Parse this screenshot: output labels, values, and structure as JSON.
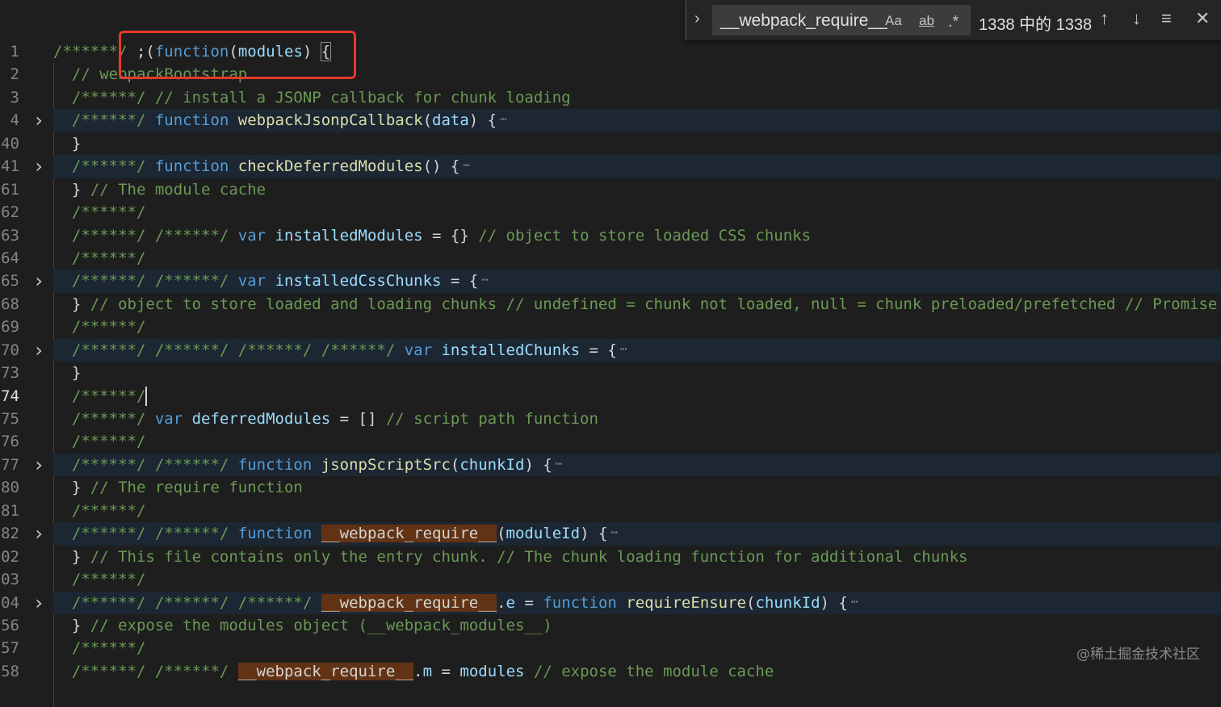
{
  "find_widget": {
    "query": "__webpack_require__",
    "match_case_label": "Aa",
    "whole_word_label": "ab",
    "regex_label": ".*",
    "result_count": "1338 中的 1338",
    "toggle_icon": "chevron-right",
    "prev_icon": "arrow-up",
    "next_icon": "arrow-down",
    "selection_icon": "find-in-selection",
    "close_icon": "close"
  },
  "colors": {
    "comment": "#6a9955",
    "keyword": "#569cd6",
    "function": "#dcdcaa",
    "variable": "#9cdcfe",
    "match": "#613214",
    "annotation": "#e5392a"
  },
  "watermark": "@稀土掘金技术社区",
  "lines": [
    {
      "num": "1",
      "tokens": [
        {
          "c": "c",
          "t": "/******/ "
        },
        {
          "c": "p",
          "t": ";("
        },
        {
          "c": "k",
          "t": "function"
        },
        {
          "c": "p",
          "t": "("
        },
        {
          "c": "v",
          "t": "modules"
        },
        {
          "c": "p",
          "t": ") "
        },
        {
          "c": "b",
          "t": "{"
        }
      ]
    },
    {
      "num": "2",
      "tokens": [
        {
          "c": "p",
          "t": "  "
        },
        {
          "c": "c",
          "t": "// webpackBootstrap"
        }
      ]
    },
    {
      "num": "3",
      "tokens": [
        {
          "c": "p",
          "t": "  "
        },
        {
          "c": "c",
          "t": "/******/ // install a JSONP callback for chunk loading"
        }
      ]
    },
    {
      "num": "4",
      "folded": true,
      "tokens": [
        {
          "c": "p",
          "t": "  "
        },
        {
          "c": "c",
          "t": "/******/ "
        },
        {
          "c": "k",
          "t": "function "
        },
        {
          "c": "f",
          "t": "webpackJsonpCallback"
        },
        {
          "c": "p",
          "t": "("
        },
        {
          "c": "v",
          "t": "data"
        },
        {
          "c": "p",
          "t": ") {"
        }
      ]
    },
    {
      "num": "40",
      "tokens": [
        {
          "c": "p",
          "t": "  }"
        }
      ]
    },
    {
      "num": "41",
      "folded": true,
      "tokens": [
        {
          "c": "p",
          "t": "  "
        },
        {
          "c": "c",
          "t": "/******/ "
        },
        {
          "c": "k",
          "t": "function "
        },
        {
          "c": "f",
          "t": "checkDeferredModules"
        },
        {
          "c": "p",
          "t": "() {"
        }
      ]
    },
    {
      "num": "61",
      "tokens": [
        {
          "c": "p",
          "t": "  } "
        },
        {
          "c": "c",
          "t": "// The module cache"
        }
      ]
    },
    {
      "num": "62",
      "tokens": [
        {
          "c": "p",
          "t": "  "
        },
        {
          "c": "c",
          "t": "/******/"
        }
      ]
    },
    {
      "num": "63",
      "tokens": [
        {
          "c": "p",
          "t": "  "
        },
        {
          "c": "c",
          "t": "/******/ /******/ "
        },
        {
          "c": "k",
          "t": "var "
        },
        {
          "c": "v",
          "t": "installedModules"
        },
        {
          "c": "p",
          "t": " = {} "
        },
        {
          "c": "c",
          "t": "// object to store loaded CSS chunks"
        }
      ]
    },
    {
      "num": "64",
      "tokens": [
        {
          "c": "p",
          "t": "  "
        },
        {
          "c": "c",
          "t": "/******/"
        }
      ]
    },
    {
      "num": "65",
      "folded": true,
      "tokens": [
        {
          "c": "p",
          "t": "  "
        },
        {
          "c": "c",
          "t": "/******/ /******/ "
        },
        {
          "c": "k",
          "t": "var "
        },
        {
          "c": "v",
          "t": "installedCssChunks"
        },
        {
          "c": "p",
          "t": " = {"
        }
      ]
    },
    {
      "num": "68",
      "tokens": [
        {
          "c": "p",
          "t": "  } "
        },
        {
          "c": "c",
          "t": "// object to store loaded and loading chunks // undefined = chunk not loaded, null = chunk preloaded/prefetched // Promise"
        }
      ]
    },
    {
      "num": "69",
      "tokens": [
        {
          "c": "p",
          "t": "  "
        },
        {
          "c": "c",
          "t": "/******/"
        }
      ]
    },
    {
      "num": "70",
      "folded": true,
      "tokens": [
        {
          "c": "p",
          "t": "  "
        },
        {
          "c": "c",
          "t": "/******/ /******/ /******/ /******/ "
        },
        {
          "c": "k",
          "t": "var "
        },
        {
          "c": "v",
          "t": "installedChunks"
        },
        {
          "c": "p",
          "t": " = {"
        }
      ]
    },
    {
      "num": "73",
      "tokens": [
        {
          "c": "p",
          "t": "  }"
        }
      ]
    },
    {
      "num": "74",
      "current": true,
      "tokens": [
        {
          "c": "p",
          "t": "  "
        },
        {
          "c": "c",
          "t": "/******/"
        }
      ]
    },
    {
      "num": "75",
      "tokens": [
        {
          "c": "p",
          "t": "  "
        },
        {
          "c": "c",
          "t": "/******/ "
        },
        {
          "c": "k",
          "t": "var "
        },
        {
          "c": "v",
          "t": "deferredModules"
        },
        {
          "c": "p",
          "t": " = [] "
        },
        {
          "c": "c",
          "t": "// script path function"
        }
      ]
    },
    {
      "num": "76",
      "tokens": [
        {
          "c": "p",
          "t": "  "
        },
        {
          "c": "c",
          "t": "/******/"
        }
      ]
    },
    {
      "num": "77",
      "folded": true,
      "tokens": [
        {
          "c": "p",
          "t": "  "
        },
        {
          "c": "c",
          "t": "/******/ /******/ "
        },
        {
          "c": "k",
          "t": "function "
        },
        {
          "c": "f",
          "t": "jsonpScriptSrc"
        },
        {
          "c": "p",
          "t": "("
        },
        {
          "c": "v",
          "t": "chunkId"
        },
        {
          "c": "p",
          "t": ") {"
        }
      ]
    },
    {
      "num": "80",
      "tokens": [
        {
          "c": "p",
          "t": "  } "
        },
        {
          "c": "c",
          "t": "// The require function"
        }
      ]
    },
    {
      "num": "81",
      "tokens": [
        {
          "c": "p",
          "t": "  "
        },
        {
          "c": "c",
          "t": "/******/"
        }
      ]
    },
    {
      "num": "82",
      "folded": true,
      "tokens": [
        {
          "c": "p",
          "t": "  "
        },
        {
          "c": "c",
          "t": "/******/ /******/ "
        },
        {
          "c": "k",
          "t": "function "
        },
        {
          "c": "m",
          "t": "__webpack_require__"
        },
        {
          "c": "p",
          "t": "("
        },
        {
          "c": "v",
          "t": "moduleId"
        },
        {
          "c": "p",
          "t": ") {"
        }
      ]
    },
    {
      "num": "02",
      "tokens": [
        {
          "c": "p",
          "t": "  } "
        },
        {
          "c": "c",
          "t": "// This file contains only the entry chunk. // The chunk loading function for additional chunks"
        }
      ]
    },
    {
      "num": "03",
      "tokens": [
        {
          "c": "p",
          "t": "  "
        },
        {
          "c": "c",
          "t": "/******/"
        }
      ]
    },
    {
      "num": "04",
      "folded": true,
      "tokens": [
        {
          "c": "p",
          "t": "  "
        },
        {
          "c": "c",
          "t": "/******/ /******/ /******/ "
        },
        {
          "c": "m",
          "t": "__webpack_require__"
        },
        {
          "c": "p",
          "t": "."
        },
        {
          "c": "v",
          "t": "e"
        },
        {
          "c": "p",
          "t": " = "
        },
        {
          "c": "k",
          "t": "function "
        },
        {
          "c": "f",
          "t": "requireEnsure"
        },
        {
          "c": "p",
          "t": "("
        },
        {
          "c": "v",
          "t": "chunkId"
        },
        {
          "c": "p",
          "t": ") {"
        }
      ]
    },
    {
      "num": "56",
      "tokens": [
        {
          "c": "p",
          "t": "  } "
        },
        {
          "c": "c",
          "t": "// expose the modules object (__webpack_modules__)"
        }
      ]
    },
    {
      "num": "57",
      "tokens": [
        {
          "c": "p",
          "t": "  "
        },
        {
          "c": "c",
          "t": "/******/"
        }
      ]
    },
    {
      "num": "58",
      "tokens": [
        {
          "c": "p",
          "t": "  "
        },
        {
          "c": "c",
          "t": "/******/ /******/ "
        },
        {
          "c": "m",
          "t": "__webpack_require__"
        },
        {
          "c": "p",
          "t": "."
        },
        {
          "c": "v",
          "t": "m"
        },
        {
          "c": "p",
          "t": " = "
        },
        {
          "c": "v",
          "t": "modules"
        },
        {
          "c": "c",
          "t": " // expose the module cache"
        }
      ]
    }
  ]
}
